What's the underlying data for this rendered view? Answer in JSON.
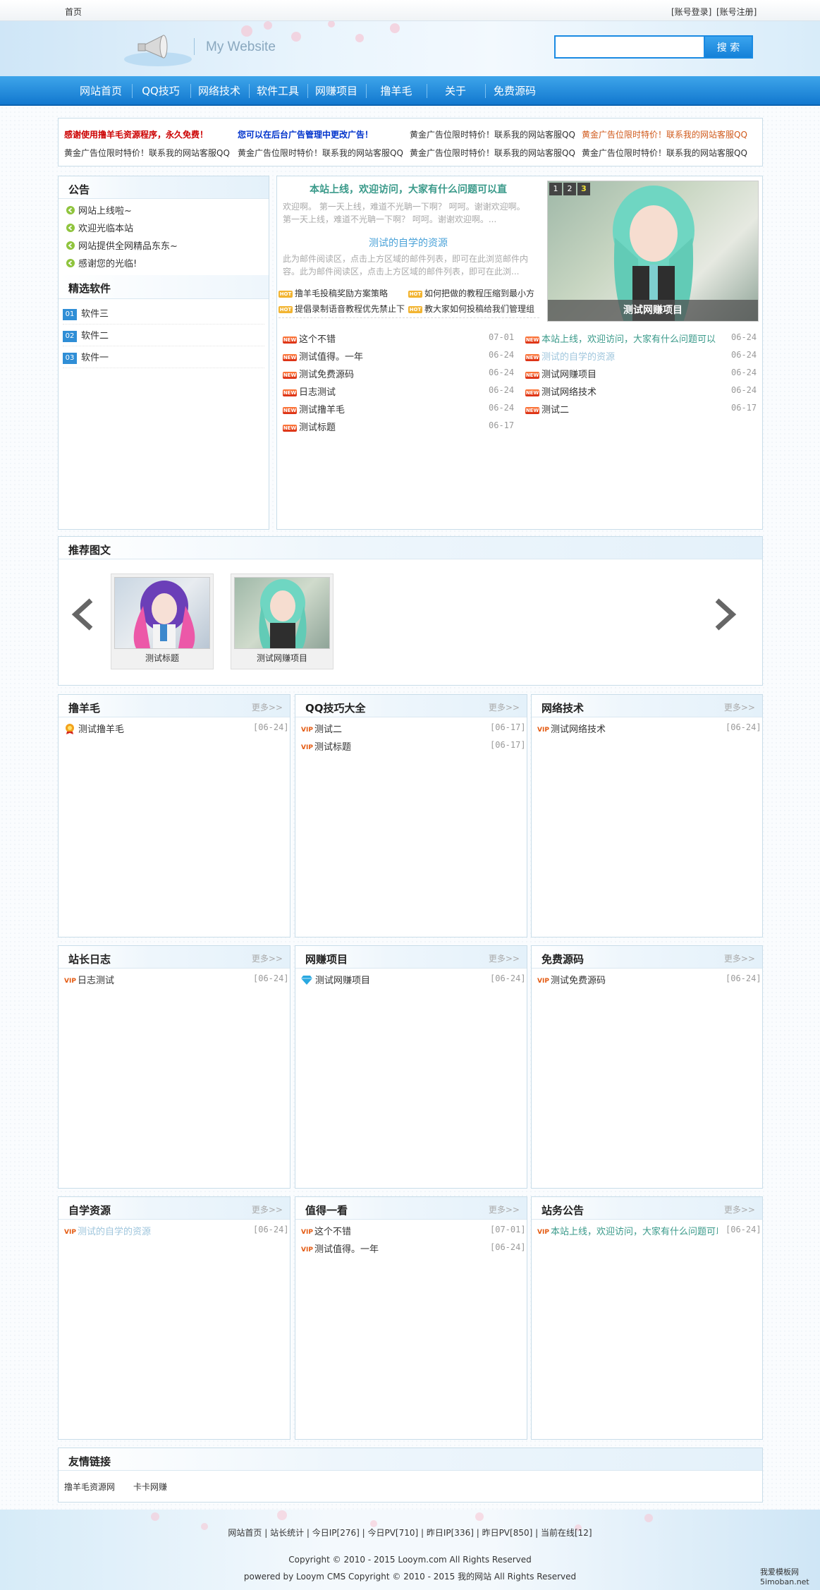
{
  "topbar": {
    "home": "首页",
    "login": "[账号登录]",
    "register": "[账号注册]"
  },
  "header": {
    "site_name": "My Website",
    "search_placeholder": "",
    "search_button": "搜 索"
  },
  "nav": [
    {
      "label": "网站首页"
    },
    {
      "label": "QQ技巧"
    },
    {
      "label": "网络技术"
    },
    {
      "label": "软件工具"
    },
    {
      "label": "网赚项目"
    },
    {
      "label": "撸羊毛"
    },
    {
      "label": "关于"
    },
    {
      "label": "免费源码"
    }
  ],
  "ads": {
    "row1": [
      "感谢使用撸羊毛资源程序，永久免费！",
      "您可以在后台广告管理中更改广告！",
      "黄金广告位限时特价！联系我的网站客服QQ",
      "黄金广告位限时特价！联系我的网站客服QQ"
    ],
    "row2": [
      "黄金广告位限时特价！联系我的网站客服QQ",
      "黄金广告位限时特价！联系我的网站客服QQ",
      "黄金广告位限时特价！联系我的网站客服QQ",
      "黄金广告位限时特价！联系我的网站客服QQ"
    ],
    "colors": [
      "#cc0000",
      "#0033cc",
      "#333333",
      "#d05a1c"
    ]
  },
  "notice": {
    "title": "公告",
    "items": [
      "网站上线啦~",
      "欢迎光临本站",
      "网站提供全网精品东东~",
      "感谢您的光临!"
    ]
  },
  "featured_software": {
    "title": "精选软件",
    "items": [
      {
        "num": "01",
        "label": "软件三"
      },
      {
        "num": "02",
        "label": "软件二"
      },
      {
        "num": "03",
        "label": "软件一"
      }
    ]
  },
  "headline": {
    "title1": "本站上线，欢迎访问，大家有什么问题可以直",
    "desc1": "欢迎啊。 第一天上线，难道不光聃一下啊？ 呵呵。谢谢欢迎啊。 第一天上线，难道不光聃一下啊？ 呵呵。谢谢欢迎啊。...",
    "title2": "测试的自学的资源",
    "desc2": "此为邮件阅读区，点击上方区域的邮件列表，即可在此浏览邮件内容。此为邮件阅读区，点击上方区域的邮件列表，即可在此浏...",
    "hot": [
      "撸羊毛投稿奖励方案策略",
      "如何把做的教程压缩到最小方",
      "提倡录制语音教程优先禁止下",
      "教大家如何投稿给我们管理组"
    ],
    "hot_badge": "HOT"
  },
  "slider": {
    "pages": [
      "1",
      "2",
      "3"
    ],
    "active": "3",
    "caption": "测试网赚项目"
  },
  "latest_left": [
    {
      "title": "这个不错",
      "date": "07-01"
    },
    {
      "title": "测试值得。一年",
      "date": "06-24"
    },
    {
      "title": "测试免费源码",
      "date": "06-24"
    },
    {
      "title": "日志测试",
      "date": "06-24"
    },
    {
      "title": "测试撸羊毛",
      "date": "06-24"
    },
    {
      "title": "测试标题",
      "date": "06-17"
    }
  ],
  "latest_right": [
    {
      "title": "本站上线，欢迎访问，大家有什么问题可以直",
      "date": "06-24",
      "color": "#3a9a8a"
    },
    {
      "title": "测试的自学的资源",
      "date": "06-24",
      "color": "#9fc6dd"
    },
    {
      "title": "测试网赚项目",
      "date": "06-24",
      "color": "#333333"
    },
    {
      "title": "测试网络技术",
      "date": "06-24",
      "color": "#333333"
    },
    {
      "title": "测试二",
      "date": "06-17",
      "color": "#333333"
    }
  ],
  "new_badge": "NEW",
  "vip_badge": "VIP",
  "recommend": {
    "title": "推荐图文",
    "items": [
      {
        "caption": "测试标题"
      },
      {
        "caption": "测试网赚项目"
      }
    ]
  },
  "more_label": "更多>>",
  "panels": [
    {
      "title": "撸羊毛",
      "icon": "award",
      "items": [
        {
          "title": "测试撸羊毛",
          "date": "[06-24]",
          "color": "#333333"
        }
      ]
    },
    {
      "title": "QQ技巧大全",
      "icon": "vip",
      "items": [
        {
          "title": "测试二",
          "date": "[06-17]",
          "color": "#333333"
        },
        {
          "title": "测试标题",
          "date": "[06-17]",
          "color": "#333333"
        }
      ]
    },
    {
      "title": "网络技术",
      "icon": "vip",
      "items": [
        {
          "title": "测试网络技术",
          "date": "[06-24]",
          "color": "#333333"
        }
      ]
    },
    {
      "title": "站长日志",
      "icon": "vip",
      "items": [
        {
          "title": "日志测试",
          "date": "[06-24]",
          "color": "#333333"
        }
      ]
    },
    {
      "title": "网赚项目",
      "icon": "diamond",
      "items": [
        {
          "title": "测试网赚项目",
          "date": "[06-24]",
          "color": "#333333"
        }
      ]
    },
    {
      "title": "免费源码",
      "icon": "vip",
      "items": [
        {
          "title": "测试免费源码",
          "date": "[06-24]",
          "color": "#333333"
        }
      ]
    },
    {
      "title": "自学资源",
      "icon": "vip",
      "items": [
        {
          "title": "测试的自学的资源",
          "date": "[06-24]",
          "color": "#9fc6dd"
        }
      ]
    },
    {
      "title": "值得一看",
      "icon": "vip",
      "items": [
        {
          "title": "这个不错",
          "date": "[07-01]",
          "color": "#333333"
        },
        {
          "title": "测试值得。一年",
          "date": "[06-24]",
          "color": "#333333"
        }
      ]
    },
    {
      "title": "站务公告",
      "icon": "vip",
      "items": [
        {
          "title": "本站上线，欢迎访问，大家有什么问题可以直",
          "date": "[06-24]",
          "color": "#3a9a8a"
        }
      ]
    }
  ],
  "friend_links": {
    "title": "友情链接",
    "items": [
      "撸羊毛资源网",
      "卡卡网赚"
    ]
  },
  "footer": {
    "links": "网站首页 | 站长统计 | 今日IP[276] | 今日PV[710] | 昨日IP[336] | 昨日PV[850] | 当前在线[12]",
    "copyright": "Copyright © 2010 - 2015 Looym.com All Rights Reserved",
    "powered": "powered by Looym CMS Copyright © 2010 - 2015 我的网站 All Rights Reserved",
    "watermark1": "我爱模板网",
    "watermark2": "5imoban.net"
  }
}
